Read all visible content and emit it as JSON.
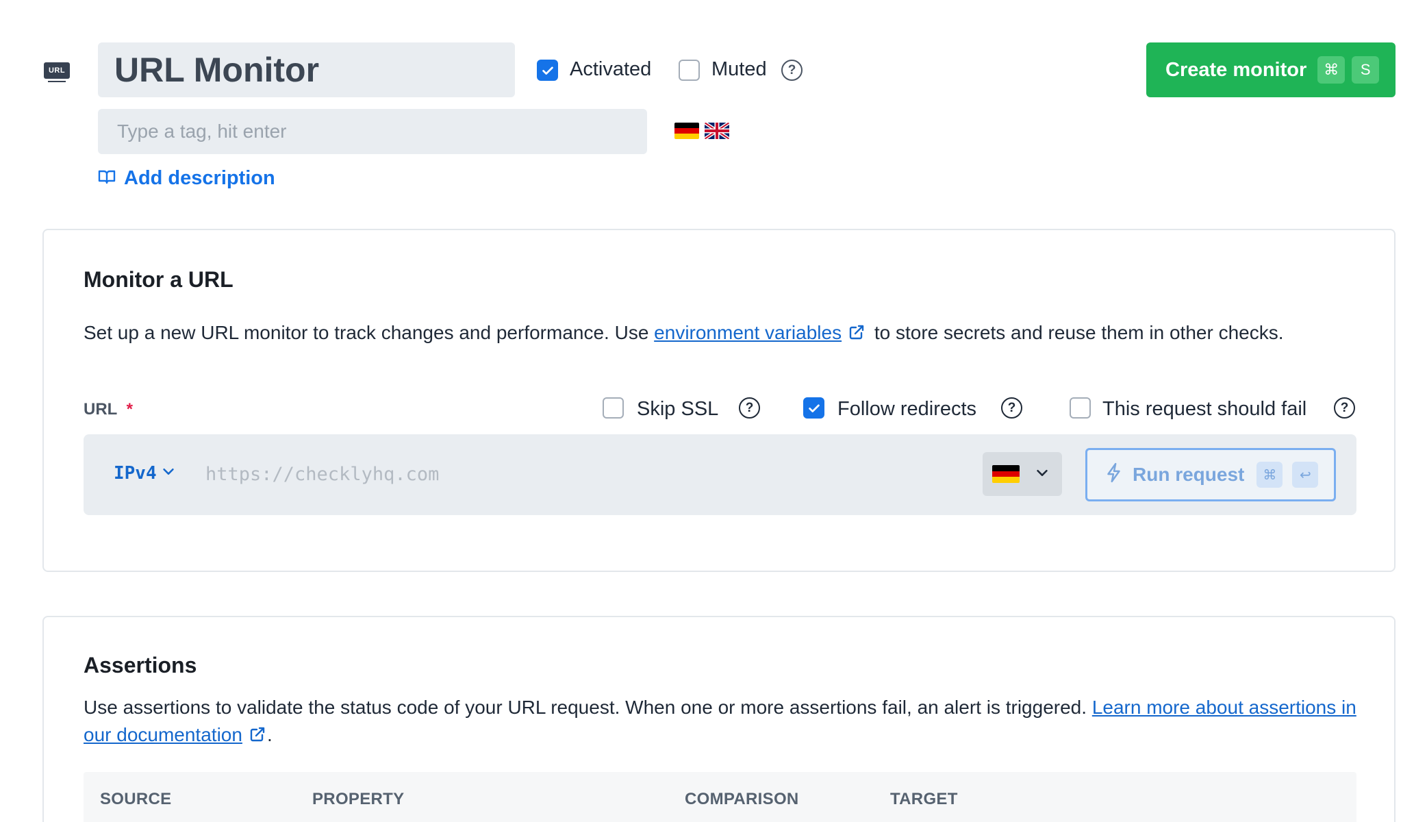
{
  "header": {
    "badge": "URL",
    "title": "URL Monitor",
    "activated_label": "Activated",
    "activated_checked": true,
    "muted_label": "Muted",
    "muted_checked": false,
    "create_button": "Create monitor",
    "create_shortcut": [
      "⌘",
      "S"
    ],
    "tag_placeholder": "Type a tag, hit enter",
    "flags": [
      "de-flag",
      "uk-flag"
    ],
    "add_description": "Add description"
  },
  "monitor_card": {
    "title": "Monitor a URL",
    "desc_before": "Set up a new URL monitor to track changes and performance. Use ",
    "desc_link": "environment variables",
    "desc_after": " to store secrets and reuse them in other checks.",
    "url_label": "URL",
    "required_marker": "*",
    "options": {
      "skip_ssl": {
        "label": "Skip SSL",
        "checked": false
      },
      "follow_redirects": {
        "label": "Follow redirects",
        "checked": true
      },
      "should_fail": {
        "label": "This request should fail",
        "checked": false
      }
    },
    "ip_version": "IPv4",
    "url_placeholder": "https://checklyhq.com",
    "run_button": "Run request",
    "run_shortcut": [
      "⌘",
      "↩"
    ]
  },
  "assertions_card": {
    "title": "Assertions",
    "desc_before": "Use assertions to validate the status code of your URL request. When one or more assertions fail, an alert is triggered. ",
    "desc_link": "Learn more about assertions in our documentation",
    "desc_after": ".",
    "columns": [
      "SOURCE",
      "PROPERTY",
      "COMPARISON",
      "TARGET"
    ]
  },
  "colors": {
    "primary": "#1573e8",
    "success": "#1fb456",
    "link": "#1467cc"
  }
}
